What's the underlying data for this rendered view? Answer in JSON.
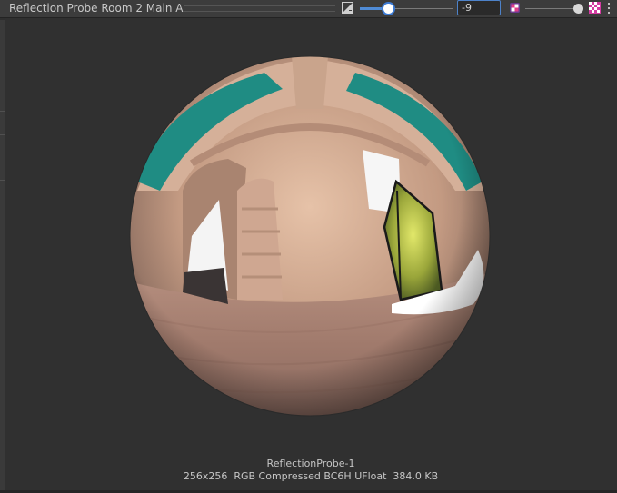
{
  "toolbar": {
    "title": "Reflection Probe Room 2 Main A",
    "exposure_icon": "exposure-icon",
    "mip_level_value": 0.08,
    "exposure_value": "-9",
    "exposure_slider_value": 1.0,
    "color_channels_icon": "rgb-channels-icon",
    "alpha_icon": "checkerboard-alpha-icon",
    "more_icon": "kebab-menu-icon"
  },
  "preview": {
    "asset_name": "ReflectionProbe-1",
    "asset_info": "256x256  RGB Compressed BC6H UFloat  384.0 KB"
  }
}
